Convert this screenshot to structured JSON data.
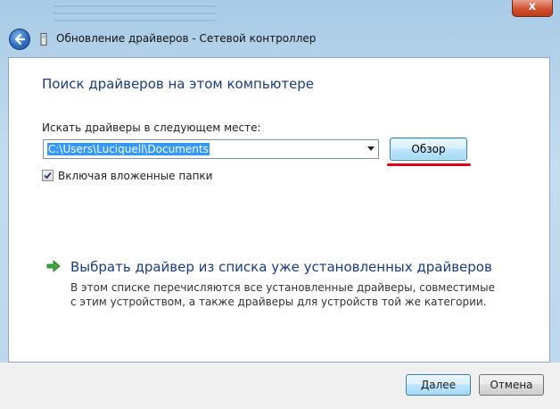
{
  "window": {
    "title": "Обновление драйверов - Сетевой контроллер",
    "close_symbol": "x"
  },
  "main": {
    "heading": "Поиск драйверов на этом компьютере",
    "search_label": "Искать драйверы в следующем месте:",
    "path_value": "C:\\Users\\Luciquell\\Documents",
    "browse_label": "Обзор",
    "include_subfolders_label": "Включая вложенные папки",
    "include_subfolders_checked": true,
    "option_title": "Выбрать драйвер из списка уже установленных драйверов",
    "option_description": "В этом списке перечисляются все установленные драйверы, совместимые с этим устройством, а также драйверы для устройств той же категории."
  },
  "footer": {
    "next_label": "Далее",
    "cancel_label": "Отмена"
  },
  "colors": {
    "heading": "#1a3b86",
    "selection": "#3399ff",
    "annotation": "#e3001b"
  },
  "icons": [
    "back-arrow-icon",
    "device-icon",
    "checkmark-icon",
    "green-arrow-icon",
    "close-icon"
  ]
}
